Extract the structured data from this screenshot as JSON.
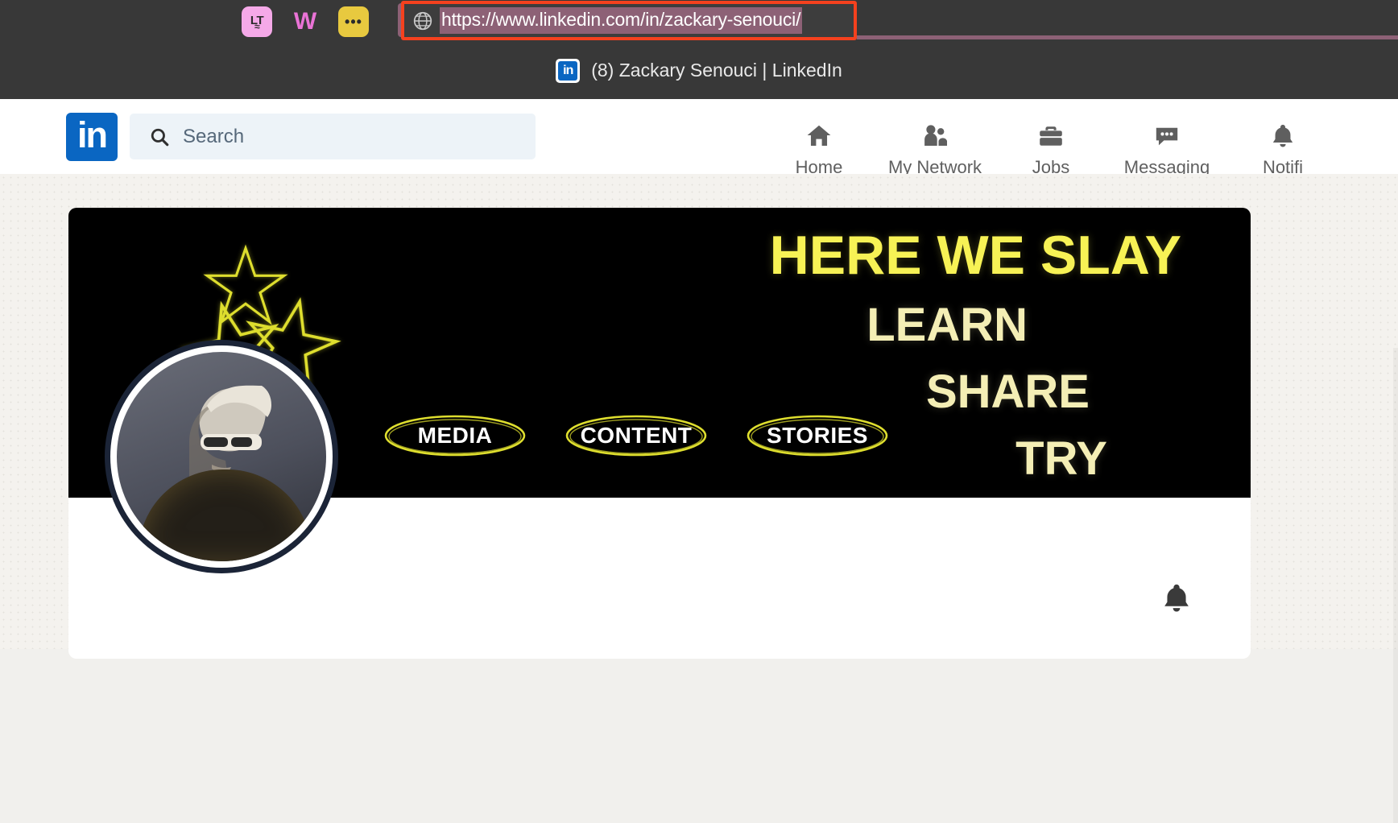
{
  "browser": {
    "extensions": [
      {
        "name": "languagetool-extension-icon",
        "label": "LT",
        "color": "#f5a9e8"
      },
      {
        "name": "wiza-extension-icon",
        "label": "W",
        "color": "#ea73d6"
      },
      {
        "name": "more-extensions-icon",
        "label": "•••",
        "color": "#e8c93f"
      }
    ],
    "address_bar": {
      "icon": "globe-icon",
      "url": "https://www.linkedin.com/in/zackary-senouci/",
      "selected": true,
      "highlight_color": "#f5411e",
      "selection_color": "#8d6176"
    },
    "tab": {
      "favicon": "linkedin-favicon",
      "favicon_text": "in",
      "title": "(8) Zackary Senouci | LinkedIn"
    }
  },
  "linkedin": {
    "logo_text": "in",
    "brand_color": "#0a66c2",
    "search": {
      "icon": "search-icon",
      "placeholder": "Search",
      "value": ""
    },
    "nav": [
      {
        "id": "home",
        "label": "Home",
        "icon": "home-icon"
      },
      {
        "id": "my-network",
        "label": "My Network",
        "icon": "people-icon"
      },
      {
        "id": "jobs",
        "label": "Jobs",
        "icon": "briefcase-icon"
      },
      {
        "id": "messaging",
        "label": "Messaging",
        "icon": "message-bubble-icon"
      },
      {
        "id": "notifications",
        "label": "Notifi",
        "icon": "bell-icon"
      }
    ]
  },
  "profile": {
    "banner": {
      "background_color": "#000000",
      "heading": "HERE WE SLAY",
      "heading_color": "#f7f255",
      "words": [
        "LEARN",
        "SHARE",
        "TRY"
      ],
      "words_color": "#f4eeb5",
      "pills": [
        "MEDIA",
        "CONTENT",
        "STORIES"
      ],
      "pill_outline_color": "#dede2e",
      "pill_text_color": "#ffffff",
      "stars_count": 3,
      "stars_color": "#dede2e"
    },
    "avatar": {
      "name": "profile-photo",
      "ring_color": "#1b2437"
    },
    "bell_icon": "notification-bell-icon"
  }
}
